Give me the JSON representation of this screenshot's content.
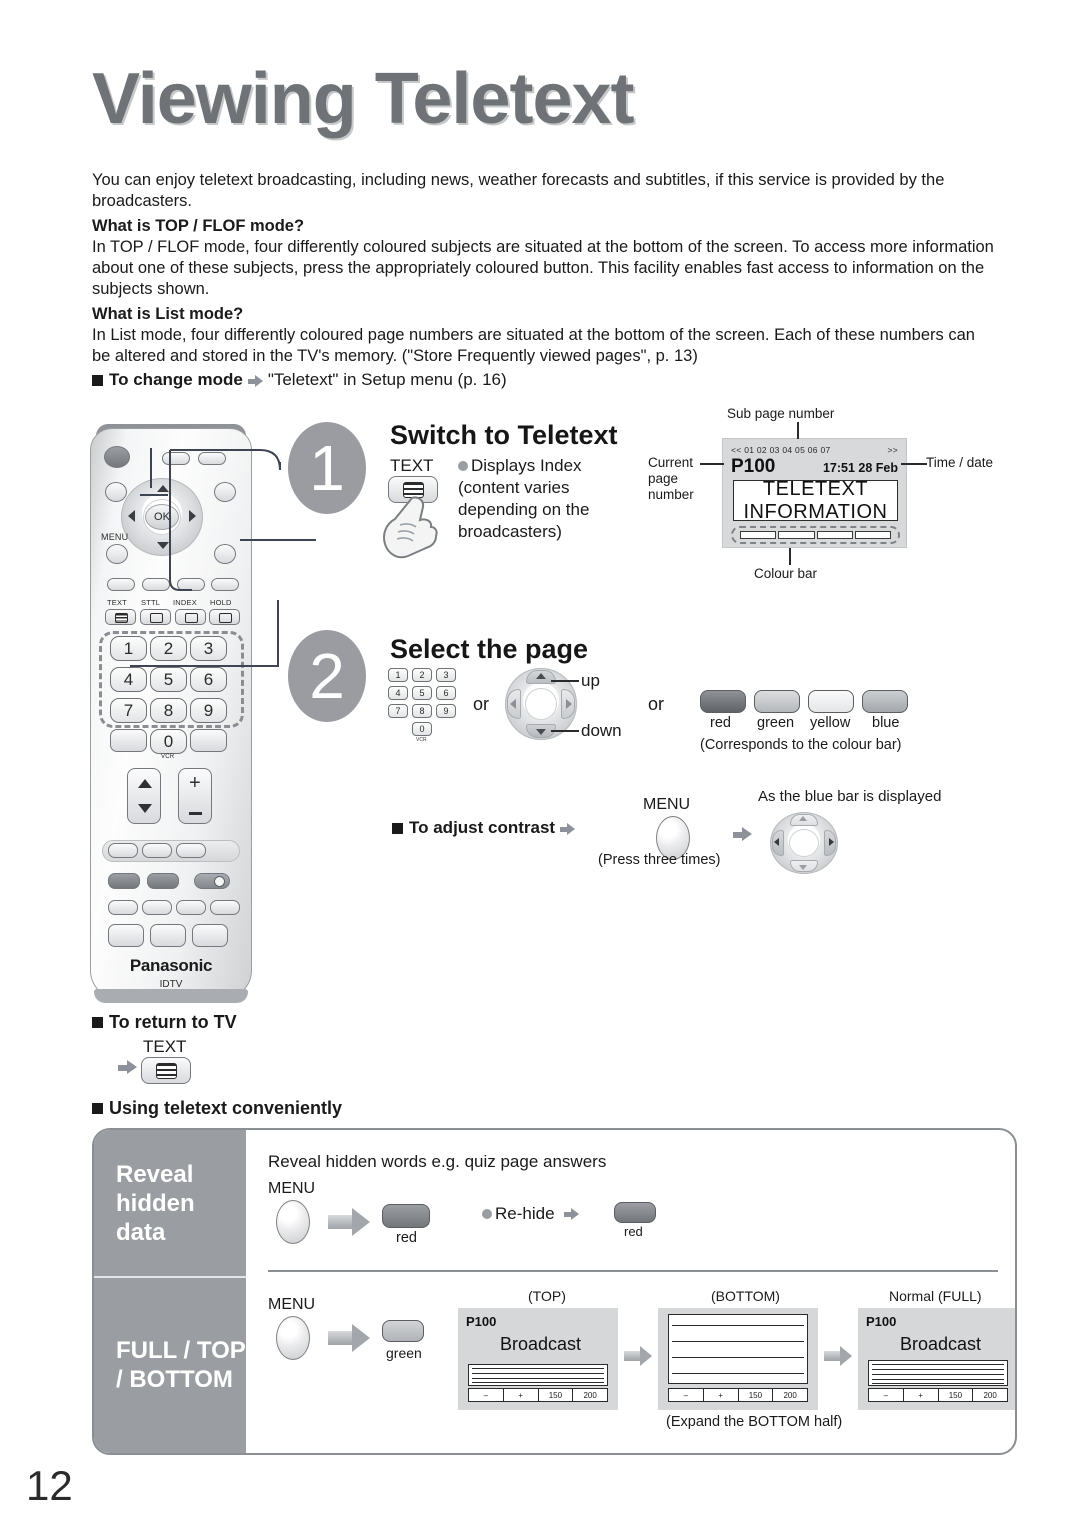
{
  "page": {
    "title": "Viewing Teletext",
    "folio": "12"
  },
  "intro": {
    "paragraph": "You can enjoy teletext broadcasting, including news, weather forecasts and subtitles, if this service is provided by the broadcasters.",
    "top_flof_heading": "What is TOP / FLOF mode?",
    "top_flof_body": "In TOP / FLOF mode, four differently coloured subjects are situated at the bottom of the screen. To access more information about one of these subjects, press the appropriately coloured button. This facility enables fast access to information on the subjects shown.",
    "list_heading": "What is List mode?",
    "list_body": "In List mode, four differently coloured page numbers are situated at the bottom of the screen. Each of these numbers can be altered and stored in the TV's memory. (\"Store Frequently viewed pages\", p. 13)",
    "change_mode_label": "To change mode",
    "change_mode_value": "\"Teletext\" in Setup menu (p. 16)"
  },
  "remote": {
    "menu_label": "MENU",
    "ok_label": "OK",
    "function_labels": [
      "TEXT",
      "STTL",
      "INDEX",
      "HOLD"
    ],
    "numbers": [
      "1",
      "2",
      "3",
      "4",
      "5",
      "6",
      "7",
      "8",
      "9",
      "0"
    ],
    "vcr_label": "VCR",
    "brand": "Panasonic",
    "model": "IDTV"
  },
  "step1": {
    "number": "1",
    "title": "Switch to Teletext",
    "button_label": "TEXT",
    "note": "Displays Index (content varies depending on the broadcasters)",
    "screen": {
      "subpages": "<< 01 02 03 04 05 06 07",
      "subpages_right": ">>",
      "page": "P100",
      "time_date": "17:51 28 Feb",
      "line1": "TELETEXT",
      "line2": "INFORMATION"
    },
    "callouts": {
      "sub_page_number": "Sub page number",
      "current_page_number": "Current page number",
      "time_date": "Time / date",
      "colour_bar": "Colour bar"
    }
  },
  "step2": {
    "number": "2",
    "title": "Select the page",
    "keypad": [
      "1",
      "2",
      "3",
      "4",
      "5",
      "6",
      "7",
      "8",
      "9",
      "0"
    ],
    "keypad_sub": "VCR",
    "or1": "or",
    "or2": "or",
    "up_label": "up",
    "down_label": "down",
    "colour_buttons": [
      "red",
      "green",
      "yellow",
      "blue"
    ],
    "colour_note": "(Corresponds to the colour bar)"
  },
  "contrast": {
    "label": "To adjust contrast",
    "menu_label": "MENU",
    "press_note": "(Press three times)",
    "blue_bar_note": "As the blue bar is displayed"
  },
  "return_to_tv": {
    "label": "To return to TV",
    "button_label": "TEXT"
  },
  "convenient": {
    "heading": "Using teletext conveniently",
    "rows": [
      {
        "side_title": "Reveal hidden data",
        "description": "Reveal hidden words e.g. quiz page answers",
        "menu_label": "MENU",
        "button_label": "red",
        "rehide_label": "Re-hide",
        "rehide_button_label": "red"
      },
      {
        "side_title": "FULL / TOP / BOTTOM",
        "menu_label": "MENU",
        "button_label": "green",
        "screens": [
          {
            "caption": "(TOP)",
            "page": "P100",
            "broadcast": "Broadcast",
            "controls": [
              "–",
              "+",
              "150",
              "200"
            ]
          },
          {
            "caption": "(BOTTOM)",
            "page": "",
            "broadcast": "",
            "controls": [
              "–",
              "+",
              "150",
              "200"
            ]
          },
          {
            "caption": "Normal (FULL)",
            "page": "P100",
            "broadcast": "Broadcast",
            "controls": [
              "–",
              "+",
              "150",
              "200"
            ]
          }
        ],
        "expand_note": "(Expand the BOTTOM half)"
      }
    ]
  },
  "colors": {
    "title_grey": "#6f7276",
    "panel_grey": "#9a9da2",
    "screen_grey": "#d8d9da",
    "arrow_grey": "#8d9199"
  }
}
